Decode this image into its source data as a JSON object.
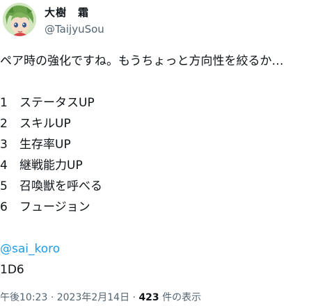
{
  "author": {
    "display_name": "大樹　霜",
    "handle": "@TaijyuSou",
    "avatar_icon": "user-avatar-anime-character"
  },
  "tweet": {
    "intro": "ペア時の強化ですね。もうちょっと方向性を絞るか…",
    "list": [
      {
        "num": "1",
        "label": "ステータスUP"
      },
      {
        "num": "2",
        "label": "スキルUP"
      },
      {
        "num": "3",
        "label": "生存率UP"
      },
      {
        "num": "4",
        "label": "継戦能力UP"
      },
      {
        "num": "5",
        "label": "召喚獣を呼べる"
      },
      {
        "num": "6",
        "label": "フュージョン"
      }
    ],
    "mention": "@sai_koro",
    "dice": "1D6"
  },
  "meta": {
    "time": "午後10:23",
    "separator": "·",
    "date": "2023年2月14日",
    "views_count": "423",
    "views_label": "件の表示"
  },
  "colors": {
    "link": "#1d9bf0",
    "text": "#0f1419",
    "secondary": "#536471"
  }
}
